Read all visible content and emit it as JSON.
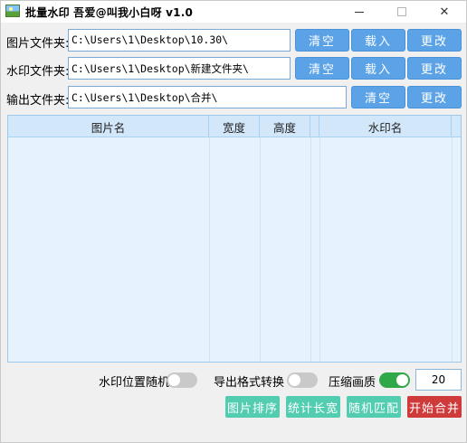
{
  "window": {
    "title": "批量水印  吾爱@叫我小白呀 v1.0",
    "close_glyph": "✕"
  },
  "rows": [
    {
      "label": "图片文件夹:",
      "path": "C:\\Users\\1\\Desktop\\10.30\\",
      "buttons": [
        "清空",
        "载入",
        "更改"
      ]
    },
    {
      "label": "水印文件夹:",
      "path": "C:\\Users\\1\\Desktop\\新建文件夹\\",
      "buttons": [
        "清空",
        "载入",
        "更改"
      ]
    },
    {
      "label": "输出文件夹:",
      "path": "C:\\Users\\1\\Desktop\\合并\\",
      "buttons": [
        "清空",
        "更改"
      ]
    }
  ],
  "table": {
    "columns": [
      "图片名",
      "宽度",
      "高度",
      "水印名"
    ]
  },
  "options": {
    "random_position": {
      "label": "水印位置随机",
      "on": false
    },
    "format_convert": {
      "label": "导出格式转换",
      "on": false
    },
    "compress": {
      "label": "压缩画质",
      "on": true
    },
    "quality_value": "20"
  },
  "actions": {
    "sort": "图片排序",
    "stats": "统计长宽",
    "random_match": "随机匹配",
    "start": "开始合并"
  },
  "colors": {
    "blue_button": "#5ba3e6",
    "teal_button": "#52cdb0",
    "red_button": "#cf3a3a",
    "toggle_on": "#2fa84a",
    "table_bg": "#e6f2fd"
  }
}
